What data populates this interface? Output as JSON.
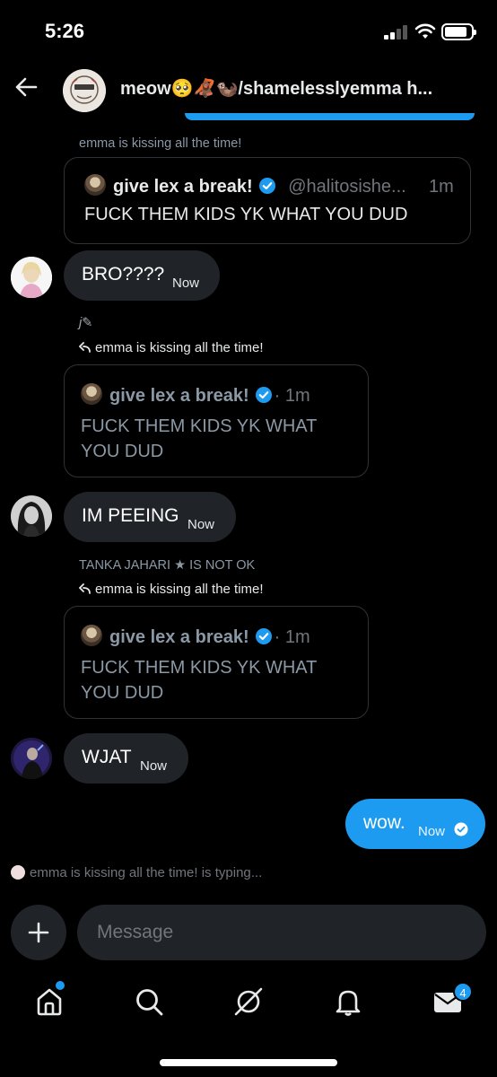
{
  "status_bar": {
    "time": "5:26",
    "battery_level": 0.85
  },
  "header": {
    "title": "meow🥺🦧🦦/shamelesslyemma h..."
  },
  "messages": [
    {
      "sender_line": "emma is kissing all the time!",
      "quote": {
        "name": "give lex a break!",
        "handle": "@halitosishe...",
        "time": "1m",
        "text": "FUCK THEM KIDS YK WHAT YOU DUD"
      }
    },
    {
      "text": "BRO????",
      "time": "Now"
    },
    {
      "sender_line": "j✎",
      "reply_to": "emma is kissing all the time!",
      "quote": {
        "name": "give lex a break!",
        "time": "· 1m",
        "text": "FUCK THEM KIDS YK WHAT YOU DUD"
      }
    },
    {
      "text": "IM PEEING",
      "time": "Now"
    },
    {
      "sender_line": "TANKA JAHARI ★ IS NOT OK",
      "reply_to": "emma is kissing all the time!",
      "quote": {
        "name": "give lex a break!",
        "time": "· 1m",
        "text": "FUCK THEM KIDS YK WHAT YOU DUD"
      }
    },
    {
      "text": "WJAT",
      "time": "Now"
    },
    {
      "text": "wow.",
      "time": "Now",
      "status": "read"
    }
  ],
  "typing_indicator": "emma is kissing all the time! is typing...",
  "composer": {
    "placeholder": "Message"
  },
  "tabbar": {
    "items": [
      "home-icon",
      "search-icon",
      "grok-icon",
      "bell-icon",
      "mail-icon"
    ],
    "messages_badge": "4"
  },
  "colors": {
    "accent": "#1d9bf0",
    "bubble": "#202327",
    "background": "#000000"
  }
}
